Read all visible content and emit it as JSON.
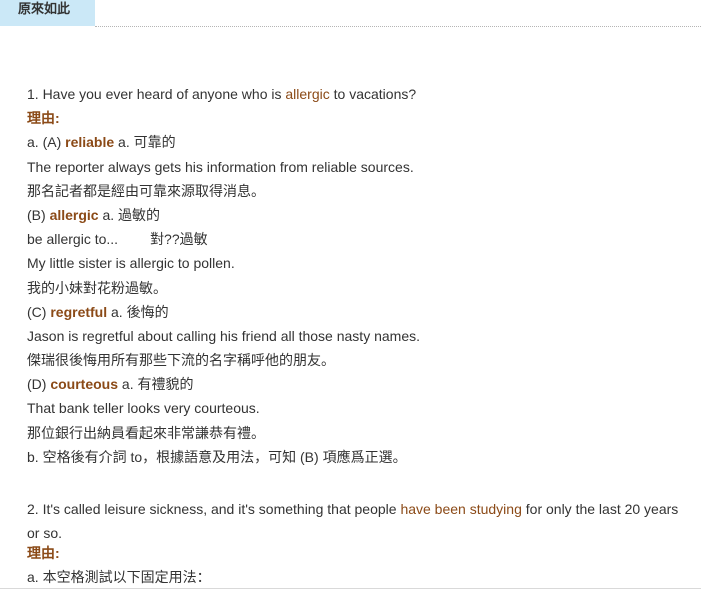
{
  "tab": {
    "label": "原來如此"
  },
  "q1": {
    "pre": "1. Have you ever heard of anyone who is ",
    "hl": "allergic",
    "post": " to vacations?",
    "reason_label": "理由:",
    "options": [
      {
        "prefix": "a. (A) ",
        "word": "reliable",
        "def": " a. 可靠的",
        "example_en": "The reporter always gets his information from reliable sources.",
        "example_zh": "那名記者都是經由可靠來源取得消息。"
      },
      {
        "prefix": "(B) ",
        "word": "allergic",
        "def": " a. 過敏的",
        "phrase": "be allergic to...",
        "phrase_meaning": "對??過敏",
        "example_en": "My little sister is allergic to pollen.",
        "example_zh": "我的小妹對花粉過敏。"
      },
      {
        "prefix": "(C) ",
        "word": "regretful",
        "def": " a. 後悔的",
        "example_en": "Jason is regretful about calling his friend all those nasty names.",
        "example_zh": "傑瑞很後悔用所有那些下流的名字稱呼他的朋友。"
      },
      {
        "prefix": "(D) ",
        "word": "courteous",
        "def": " a. 有禮貌的",
        "example_en": "That bank teller looks very courteous.",
        "example_zh": "那位銀行出納員看起來非常謙恭有禮。"
      }
    ],
    "conclusion": "b. 空格後有介詞 to，根據語意及用法，可知 (B) 項應爲正選。"
  },
  "q2": {
    "pre": "2. It's called leisure sickness, and it's something that people ",
    "hl": "have been studying",
    "post": " for only the last 20 years or so.",
    "reason_label": "理由:",
    "note": "a. 本空格測試以下固定用法："
  }
}
